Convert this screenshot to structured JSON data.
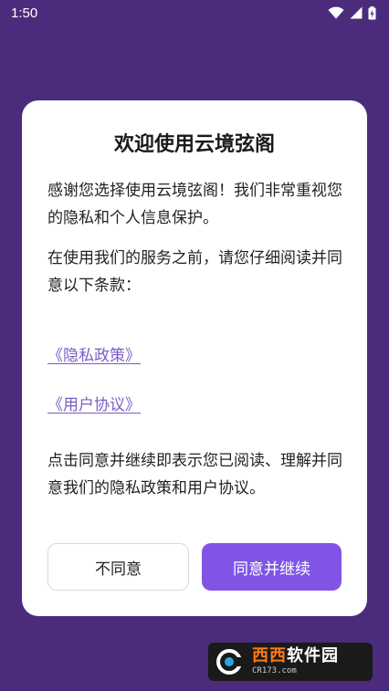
{
  "status_bar": {
    "time": "1:50"
  },
  "dialog": {
    "title": "欢迎使用云境弦阁",
    "paragraph_1": "感谢您选择使用云境弦阁！我们非常重视您的隐私和个人信息保护。",
    "paragraph_2": "在使用我们的服务之前，请您仔细阅读并同意以下条款：",
    "privacy_link": "《隐私政策》",
    "user_agreement_link": "《用户协议》",
    "paragraph_3": "点击同意并继续即表示您已阅读、理解并同意我们的隐私政策和用户协议。",
    "decline_label": "不同意",
    "accept_label": "同意并继续"
  },
  "watermark": {
    "brand_colored": "西西",
    "brand_plain": "软件园",
    "url": "CR173.com"
  },
  "colors": {
    "background": "#4b2c7c",
    "accent": "#8154e6",
    "link": "#7b5cc4"
  },
  "icons": {
    "status": [
      "wifi-icon",
      "cellular-signal-icon",
      "battery-charging-icon"
    ]
  }
}
